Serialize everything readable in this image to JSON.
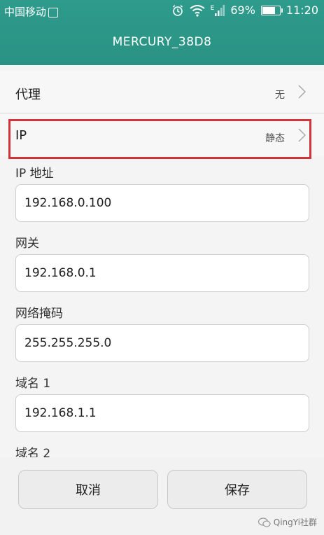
{
  "status_bar": {
    "carrier": "中国移动",
    "sim_icon": "sim-icon",
    "signal_label": "E",
    "battery_text": "69%",
    "battery_level": 0.69,
    "time": "11:20"
  },
  "header": {
    "title": "MERCURY_38D8",
    "color": "#2e9b8c"
  },
  "rows": {
    "proxy": {
      "label": "代理",
      "value": "无"
    },
    "ip": {
      "label": "IP",
      "value": "静态"
    }
  },
  "fields": {
    "ip_address": {
      "label": "IP 地址",
      "value": "192.168.0.100"
    },
    "gateway": {
      "label": "网关",
      "value": "192.168.0.1"
    },
    "netmask": {
      "label": "网络掩码",
      "value": "255.255.255.0"
    },
    "dns1": {
      "label": "域名 1",
      "value": "192.168.1.1"
    },
    "dns2": {
      "label": "域名 2"
    }
  },
  "buttons": {
    "cancel": "取消",
    "save": "保存"
  },
  "watermark": {
    "text": "QingYi社群"
  },
  "highlight_color": "#d0343a"
}
